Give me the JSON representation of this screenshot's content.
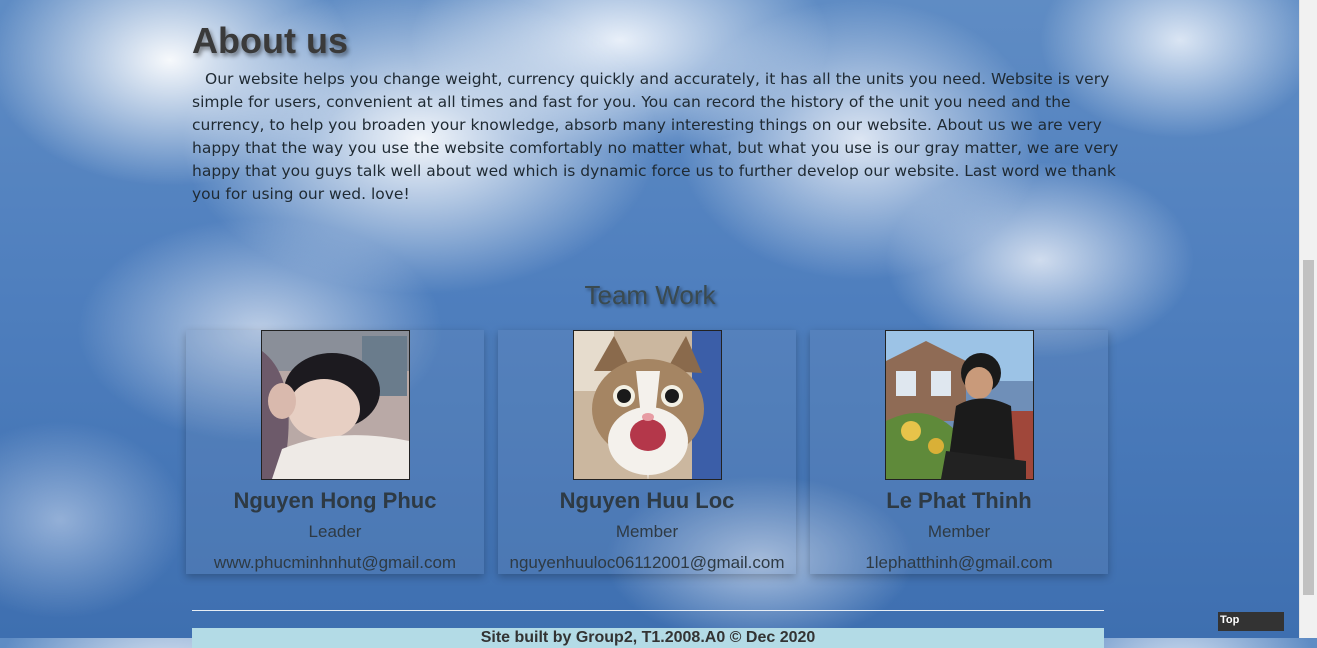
{
  "about": {
    "title": "About us",
    "text": "Our website helps you change weight, currency quickly and accurately, it has all the units you need. Website is very simple for users, convenient at all times and fast for you. You can record the history of the unit you need and the currency, to help you broaden your knowledge, absorb many interesting things on our website. About us we are very happy that the way you use the website comfortably no matter what, but what you use is our gray matter, we are very happy that you guys talk well about wed which is dynamic force us to further develop our website. Last word we thank you for using our wed. love!"
  },
  "team": {
    "title": "Team Work",
    "members": [
      {
        "name": "Nguyen Hong Phuc",
        "role": "Leader",
        "email": "www.phucminhnhut@gmail.com"
      },
      {
        "name": "Nguyen Huu Loc",
        "role": "Member",
        "email": "nguyenhuuloc06112001@gmail.com"
      },
      {
        "name": "Le Phat Thinh",
        "role": "Member",
        "email": "1lephatthinh@gmail.com"
      }
    ]
  },
  "footer": {
    "text": "Site built by Group2, T1.2008.A0 © Dec 2020"
  },
  "top_button": {
    "label": "Top"
  }
}
